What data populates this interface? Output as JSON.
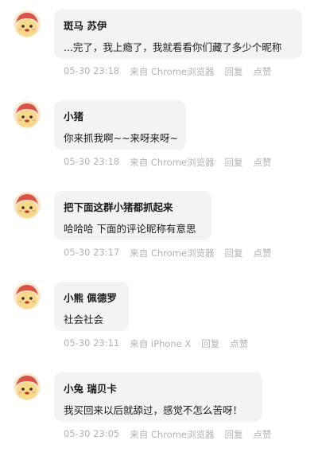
{
  "comments": [
    {
      "name": "斑马 苏伊",
      "text": "...完了，我上瘾了，我就看看你们藏了多少个昵称",
      "time": "05-30 23:18",
      "source": "来自 Chrome浏览器",
      "reply": "回复",
      "like": "点赞"
    },
    {
      "name": "小猪",
      "text": "你来抓我啊~~来呀来呀~",
      "time": "05-30 23:18",
      "source": "来自 Chrome浏览器",
      "reply": "回复",
      "like": "点赞"
    },
    {
      "name": "把下面这群小猪都抓起来",
      "text": "哈哈哈 下面的评论昵称有意思",
      "time": "05-30 23:17",
      "source": "来自 Chrome浏览器",
      "reply": "回复",
      "like": "点赞"
    },
    {
      "name": "小熊 佩德罗",
      "text": "社会社会",
      "time": "05-30 23:11",
      "source": "来自 iPhone X",
      "reply": "回复",
      "like": "点赞"
    },
    {
      "name": "小兔 瑞贝卡",
      "text": "我买回来以后就舔过，感觉不怎么苦呀！",
      "time": "05-30 23:05",
      "source": "来自 Chrome浏览器",
      "reply": "回复",
      "like": "点赞"
    }
  ],
  "colors": {
    "bubble": "#f3f3f3",
    "text": "#1a1a1a",
    "meta": "#b2b2b2",
    "avatar_face": "#f6d98a",
    "avatar_hair": "#d9534a"
  },
  "icons": {
    "avatar": "cartoon-avatar-icon"
  }
}
